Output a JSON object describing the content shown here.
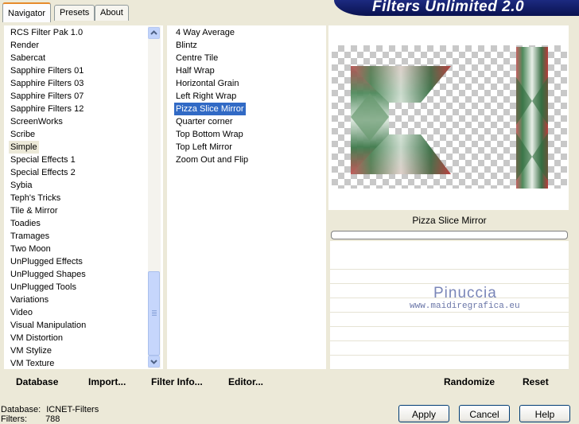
{
  "banner": {
    "title": "Filters Unlimited 2.0"
  },
  "tabs": [
    {
      "label": "Navigator",
      "active": true
    },
    {
      "label": "Presets",
      "active": false
    },
    {
      "label": "About",
      "active": false
    }
  ],
  "categories": [
    "RCS Filter Pak 1.0",
    "Render",
    "Sabercat",
    "Sapphire Filters 01",
    "Sapphire Filters 03",
    "Sapphire Filters 07",
    "Sapphire Filters 12",
    "ScreenWorks",
    "Scribe",
    "Simple",
    "Special Effects 1",
    "Special Effects 2",
    "Sybia",
    "Teph's Tricks",
    "Tile & Mirror",
    "Toadies",
    "Tramages",
    "Two Moon",
    "UnPlugged Effects",
    "UnPlugged Shapes",
    "UnPlugged Tools",
    "Variations",
    "Video",
    "Visual Manipulation",
    "VM Distortion",
    "VM Stylize",
    "VM Texture"
  ],
  "selected_category": "Simple",
  "filters": [
    "4 Way Average",
    "Blintz",
    "Centre Tile",
    "Half Wrap",
    "Horizontal Grain",
    "Left Right Wrap",
    "Pizza Slice Mirror",
    "Quarter corner",
    "Top Bottom Wrap",
    "Top Left Mirror",
    "Zoom Out and Flip"
  ],
  "selected_filter": "Pizza Slice Mirror",
  "preview": {
    "filter_name": "Pizza Slice Mirror"
  },
  "watermark": {
    "name": "Pinuccia",
    "site": "www.maidiregrafica.eu"
  },
  "left_toolbar": {
    "database": "Database",
    "import": "Import...",
    "filter_info": "Filter Info...",
    "editor": "Editor..."
  },
  "right_toolbar": {
    "randomize": "Randomize",
    "reset": "Reset"
  },
  "status": {
    "database_label": "Database:",
    "database_value": "ICNET-Filters",
    "filters_label": "Filters:",
    "filters_value": "788"
  },
  "buttons": {
    "apply": "Apply",
    "cancel": "Cancel",
    "help": "Help"
  },
  "colors": {
    "selection": "#316ac5",
    "banner": "#0a1250",
    "background": "#ece9d8"
  }
}
